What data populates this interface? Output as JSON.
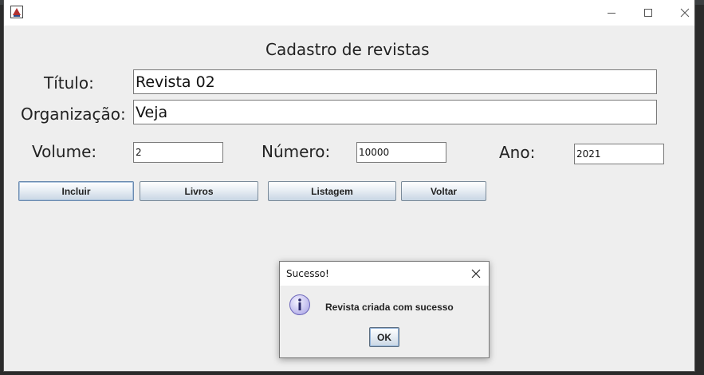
{
  "window": {
    "heading": "Cadastro de revistas"
  },
  "form": {
    "titulo_label": "Título:",
    "titulo_value": "Revista 02",
    "organizacao_label": "Organização:",
    "organizacao_value": "Veja",
    "volume_label": "Volume:",
    "volume_value": "2",
    "numero_label": "Número:",
    "numero_value": "10000",
    "ano_label": "Ano:",
    "ano_value": "2021"
  },
  "buttons": {
    "incluir": "Incluir",
    "livros": "Livros",
    "listagem": "Listagem",
    "voltar": "Voltar"
  },
  "dialog": {
    "title": "Sucesso!",
    "message": "Revista criada com sucesso",
    "ok_label": "OK",
    "icon": "info-icon"
  },
  "colors": {
    "window_bg": "#eeeeee",
    "button_gradient_bottom": "#c8d6e4",
    "info_icon_fill": "#c9c6f2"
  }
}
